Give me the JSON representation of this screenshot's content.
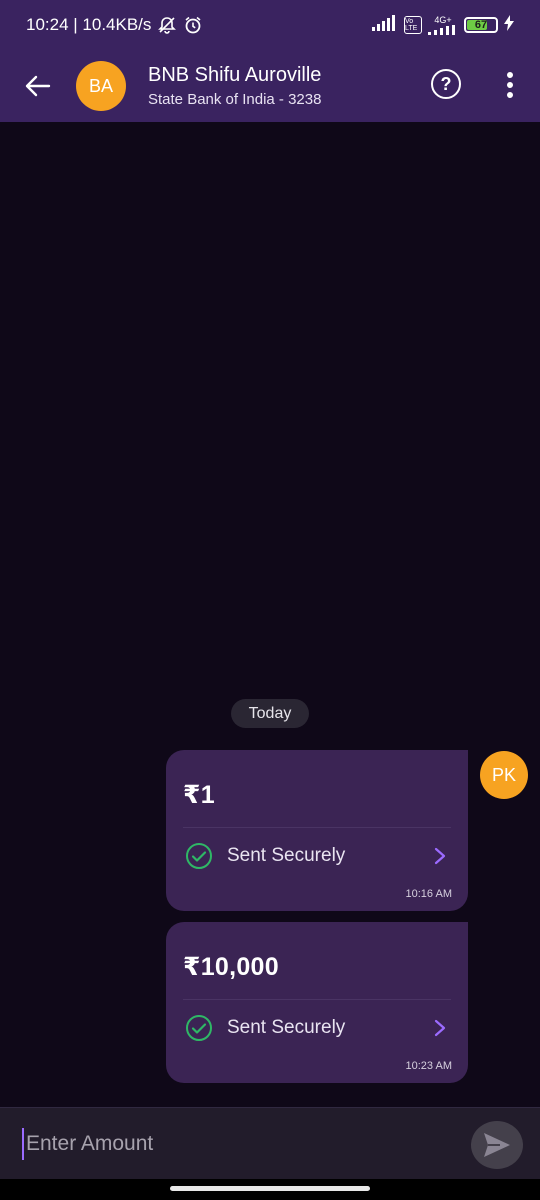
{
  "status_bar": {
    "time_speed": "10:24 | 10.4KB/s",
    "network_label": "4G+",
    "volte_label": "Vo LTE",
    "battery_level": "67"
  },
  "header": {
    "avatar_initials": "BA",
    "title": "BNB Shifu Auroville",
    "subtitle": "State Bank of India - 3238",
    "help_label": "?"
  },
  "chat": {
    "date_chip": "Today",
    "sender_initials": "PK",
    "messages": [
      {
        "amount": "₹1",
        "status": "Sent Securely",
        "time": "10:16 AM"
      },
      {
        "amount": "₹10,000",
        "status": "Sent Securely",
        "time": "10:23 AM"
      }
    ]
  },
  "input": {
    "placeholder": "Enter Amount"
  },
  "colors": {
    "header_bg": "#3a2360",
    "chat_bg": "#0f0818",
    "bubble_bg": "#3b2454",
    "avatar_bg": "#f7a321",
    "success_green": "#2fb866",
    "accent_purple": "#9b6bff"
  },
  "icons": {
    "back": "back-arrow-icon",
    "help": "question-circle-icon",
    "more": "more-vertical-icon",
    "check": "check-circle-icon",
    "chevron": "chevron-right-icon",
    "send": "send-icon"
  }
}
